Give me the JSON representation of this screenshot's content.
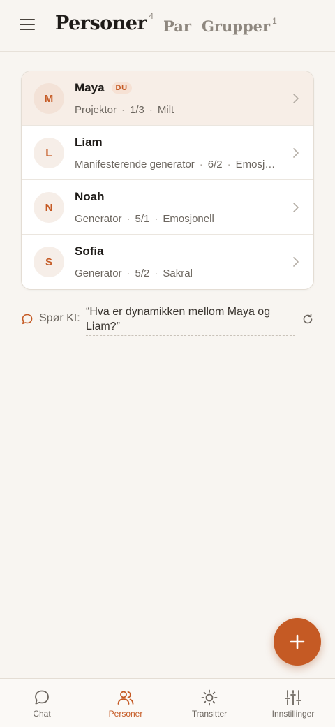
{
  "header": {
    "tabs": [
      {
        "label": "Personer",
        "count": "4",
        "active": true
      },
      {
        "label": "Par",
        "count": "",
        "active": false
      },
      {
        "label": "Grupper",
        "count": "1",
        "active": false
      }
    ]
  },
  "people": [
    {
      "initial": "M",
      "name": "Maya",
      "badge": "DU",
      "type": "Projektor",
      "profile": "1/3",
      "authority": "Milt"
    },
    {
      "initial": "L",
      "name": "Liam",
      "badge": "",
      "type": "Manifesterende generator",
      "profile": "6/2",
      "authority": "Emosjonell"
    },
    {
      "initial": "N",
      "name": "Noah",
      "badge": "",
      "type": "Generator",
      "profile": "5/1",
      "authority": "Emosjonell"
    },
    {
      "initial": "S",
      "name": "Sofia",
      "badge": "",
      "type": "Generator",
      "profile": "5/2",
      "authority": "Sakral"
    }
  ],
  "ask_ai": {
    "label": "Spør KI:",
    "question": "“Hva er dynamikken mellom Maya og Liam?”"
  },
  "bottom_nav": [
    {
      "label": "Chat",
      "icon": "chat-icon",
      "active": false
    },
    {
      "label": "Personer",
      "icon": "people-icon",
      "active": true
    },
    {
      "label": "Transitter",
      "icon": "sun-icon",
      "active": false
    },
    {
      "label": "Innstillinger",
      "icon": "sliders-icon",
      "active": false
    }
  ],
  "colors": {
    "accent": "#c55a24",
    "background": "#f8f5f1",
    "muted": "#6d6760"
  }
}
